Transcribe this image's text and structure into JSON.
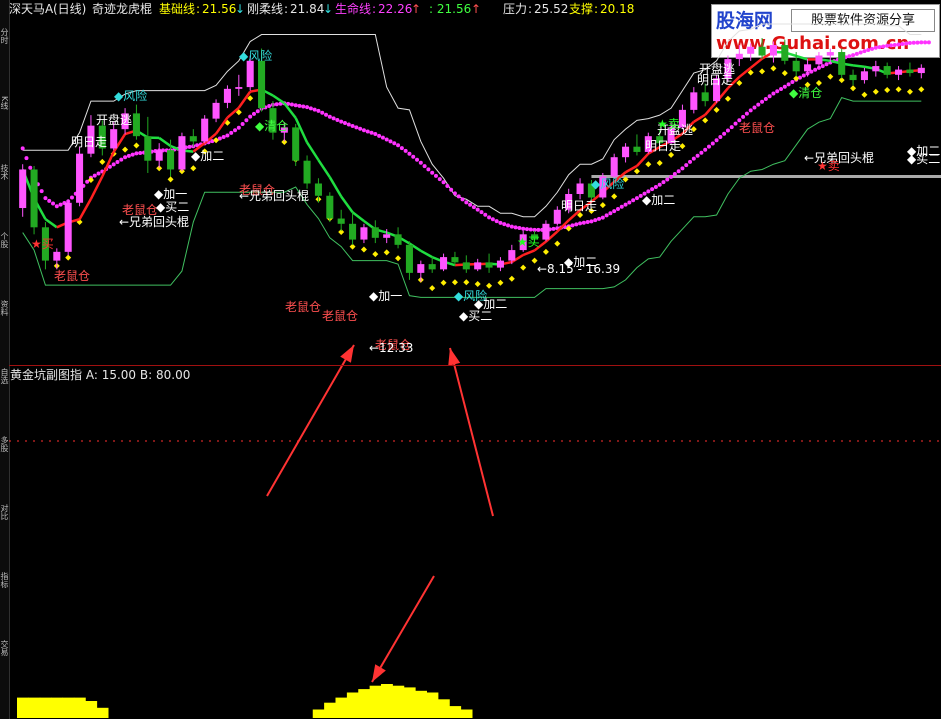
{
  "window": {
    "stock_name": "深天马A",
    "period": "(日线)",
    "indicator_name": "奇迹龙虎棍"
  },
  "header": {
    "base_line_label": "基础线",
    "base_line_value": "21.56",
    "base_line_arrow": "↓",
    "rigid_line_label": "刚柔线",
    "rigid_line_value": "21.84",
    "rigid_line_arrow": "↓",
    "life_line_label": "生命线",
    "life_line_value": "22.26",
    "life_line_arrow": "↑",
    "extra_value": ": 21.56",
    "extra_arrow": "↑",
    "pressure_label": "压力",
    "pressure_value": "25.52",
    "support_label": "支撑",
    "support_value": "20.18"
  },
  "watermark": {
    "logo": "股海网",
    "slogan": "股票软件资源分享",
    "url": "www.Guhai.com.cn"
  },
  "sub_panel": {
    "title": "黄金坑副图指",
    "param_a_label": "A",
    "param_a_value": "15.00",
    "param_b_label": "B",
    "param_b_value": "80.00"
  },
  "left_tabs": [
    "分时",
    "K线",
    "技术",
    "个股",
    "资料",
    "自选",
    "多股",
    "对比",
    "指标",
    "交易"
  ],
  "chart_labels": {
    "risk": "◆风险",
    "clear": "◆清仓",
    "open_escape": "开盘逃",
    "tomorrow_go": "明日走",
    "mouse_warehouse": "老鼠仓",
    "add_one": "加一",
    "add_two": "加二",
    "buy_one": "买一",
    "buy_two": "买二",
    "brother_stick": "←兄弟回头棍",
    "buy": "买",
    "sell": "卖",
    "low_price": "←12.33",
    "range_text": "←8.15 - 16.39"
  },
  "chart_data": {
    "type": "candlestick",
    "series_colors": {
      "up": "#ff55ff",
      "down": "#22aa22",
      "flat": "#b0b0b0",
      "magenta_dots": "#ff33ff",
      "yellow_dots": "#ffee00",
      "support_line": "#40c060",
      "pressure_line": "#e0e0e0",
      "sub_fill": "#ffff00"
    },
    "price_range": [
      8,
      27
    ],
    "candles": [
      [
        16.5,
        19.0,
        16.0,
        18.7
      ],
      [
        18.7,
        18.9,
        15.0,
        15.4
      ],
      [
        15.4,
        15.7,
        13.0,
        13.5
      ],
      [
        13.5,
        14.2,
        13.0,
        14.0
      ],
      [
        14.0,
        17.0,
        13.8,
        16.8
      ],
      [
        16.8,
        20.0,
        16.6,
        19.6
      ],
      [
        19.6,
        21.8,
        19.4,
        21.2
      ],
      [
        21.2,
        21.5,
        19.5,
        19.9
      ],
      [
        19.9,
        21.4,
        19.8,
        21.0
      ],
      [
        21.0,
        22.2,
        20.7,
        21.9
      ],
      [
        21.9,
        22.4,
        20.4,
        20.6
      ],
      [
        20.6,
        21.7,
        18.5,
        19.2
      ],
      [
        19.2,
        20.2,
        18.8,
        19.8
      ],
      [
        19.8,
        20.4,
        18.3,
        18.7
      ],
      [
        18.7,
        20.8,
        18.6,
        20.6
      ],
      [
        20.6,
        21.0,
        20.0,
        20.3
      ],
      [
        20.3,
        21.8,
        20.2,
        21.6
      ],
      [
        21.6,
        22.7,
        21.4,
        22.5
      ],
      [
        22.5,
        23.5,
        22.2,
        23.3
      ],
      [
        23.3,
        24.1,
        22.9,
        23.4
      ],
      [
        23.4,
        25.2,
        23.2,
        24.9
      ],
      [
        24.9,
        25.6,
        22.0,
        22.2
      ],
      [
        22.2,
        22.6,
        20.4,
        20.8
      ],
      [
        20.8,
        21.4,
        20.3,
        21.1
      ],
      [
        21.1,
        21.3,
        18.9,
        19.2
      ],
      [
        19.2,
        19.5,
        17.6,
        17.9
      ],
      [
        17.9,
        18.2,
        16.8,
        17.2
      ],
      [
        17.2,
        17.4,
        15.7,
        15.9
      ],
      [
        15.9,
        16.4,
        15.2,
        15.6
      ],
      [
        15.6,
        16.2,
        14.4,
        14.7
      ],
      [
        14.7,
        15.6,
        14.5,
        15.4
      ],
      [
        15.4,
        15.8,
        14.5,
        14.8
      ],
      [
        14.8,
        15.3,
        14.5,
        15.0
      ],
      [
        15.0,
        15.4,
        14.2,
        14.4
      ],
      [
        14.4,
        14.6,
        12.4,
        12.8
      ],
      [
        12.8,
        13.5,
        12.3,
        13.3
      ],
      [
        13.3,
        13.7,
        12.8,
        13.0
      ],
      [
        13.0,
        13.9,
        12.9,
        13.7
      ],
      [
        13.7,
        14.0,
        13.2,
        13.4
      ],
      [
        13.4,
        13.8,
        12.8,
        13.0
      ],
      [
        13.0,
        13.6,
        12.9,
        13.4
      ],
      [
        13.4,
        13.9,
        12.8,
        13.1
      ],
      [
        13.1,
        13.7,
        12.9,
        13.5
      ],
      [
        13.5,
        14.4,
        13.3,
        14.1
      ],
      [
        14.1,
        15.2,
        14.0,
        15.0
      ],
      [
        15.0,
        15.2,
        14.5,
        14.7
      ],
      [
        14.7,
        15.8,
        14.6,
        15.6
      ],
      [
        15.6,
        16.6,
        15.5,
        16.4
      ],
      [
        16.4,
        17.6,
        16.2,
        17.3
      ],
      [
        17.3,
        18.2,
        17.0,
        17.9
      ],
      [
        17.9,
        18.1,
        16.9,
        17.1
      ],
      [
        17.1,
        18.5,
        17.0,
        18.3
      ],
      [
        18.3,
        19.6,
        18.2,
        19.4
      ],
      [
        19.4,
        20.2,
        19.1,
        20.0
      ],
      [
        20.0,
        20.7,
        19.5,
        19.7
      ],
      [
        19.7,
        20.8,
        19.6,
        20.6
      ],
      [
        20.6,
        21.0,
        19.9,
        20.2
      ],
      [
        20.2,
        21.4,
        20.1,
        21.1
      ],
      [
        21.1,
        22.4,
        21.0,
        22.1
      ],
      [
        22.1,
        23.4,
        21.9,
        23.1
      ],
      [
        23.1,
        23.6,
        22.3,
        22.6
      ],
      [
        22.6,
        24.1,
        22.5,
        23.9
      ],
      [
        23.9,
        25.2,
        23.7,
        25.0
      ],
      [
        25.0,
        25.8,
        24.6,
        25.3
      ],
      [
        25.3,
        25.9,
        24.9,
        25.7
      ],
      [
        25.7,
        26.2,
        25.0,
        25.2
      ],
      [
        25.2,
        26.0,
        24.8,
        25.8
      ],
      [
        25.8,
        26.1,
        24.7,
        24.9
      ],
      [
        24.9,
        25.4,
        24.0,
        24.3
      ],
      [
        24.3,
        25.0,
        24.0,
        24.7
      ],
      [
        24.7,
        25.4,
        24.5,
        25.2
      ],
      [
        25.2,
        25.6,
        24.8,
        25.4
      ],
      [
        25.4,
        25.6,
        23.9,
        24.1
      ],
      [
        24.1,
        24.4,
        23.5,
        23.8
      ],
      [
        23.8,
        24.5,
        23.6,
        24.3
      ],
      [
        24.3,
        24.9,
        24.0,
        24.6
      ],
      [
        24.6,
        24.8,
        23.9,
        24.1
      ],
      [
        24.1,
        24.6,
        23.8,
        24.4
      ],
      [
        24.4,
        24.8,
        24.0,
        24.2
      ],
      [
        24.2,
        24.7,
        23.9,
        24.5
      ]
    ],
    "sub_values": [
      0.6,
      0.6,
      0.6,
      0.6,
      0.6,
      0.6,
      0.5,
      0.3,
      0,
      0,
      0,
      0,
      0,
      0,
      0,
      0,
      0,
      0,
      0,
      0,
      0,
      0,
      0,
      0,
      0,
      0,
      0.25,
      0.45,
      0.6,
      0.75,
      0.85,
      0.95,
      1.0,
      0.95,
      0.9,
      0.8,
      0.75,
      0.55,
      0.35,
      0.25,
      0,
      0,
      0,
      0,
      0,
      0,
      0,
      0,
      0,
      0,
      0,
      0,
      0,
      0,
      0,
      0,
      0,
      0,
      0,
      0,
      0,
      0,
      0,
      0,
      0,
      0,
      0,
      0,
      0,
      0,
      0,
      0,
      0,
      0,
      0,
      0,
      0,
      0,
      0,
      0
    ]
  }
}
